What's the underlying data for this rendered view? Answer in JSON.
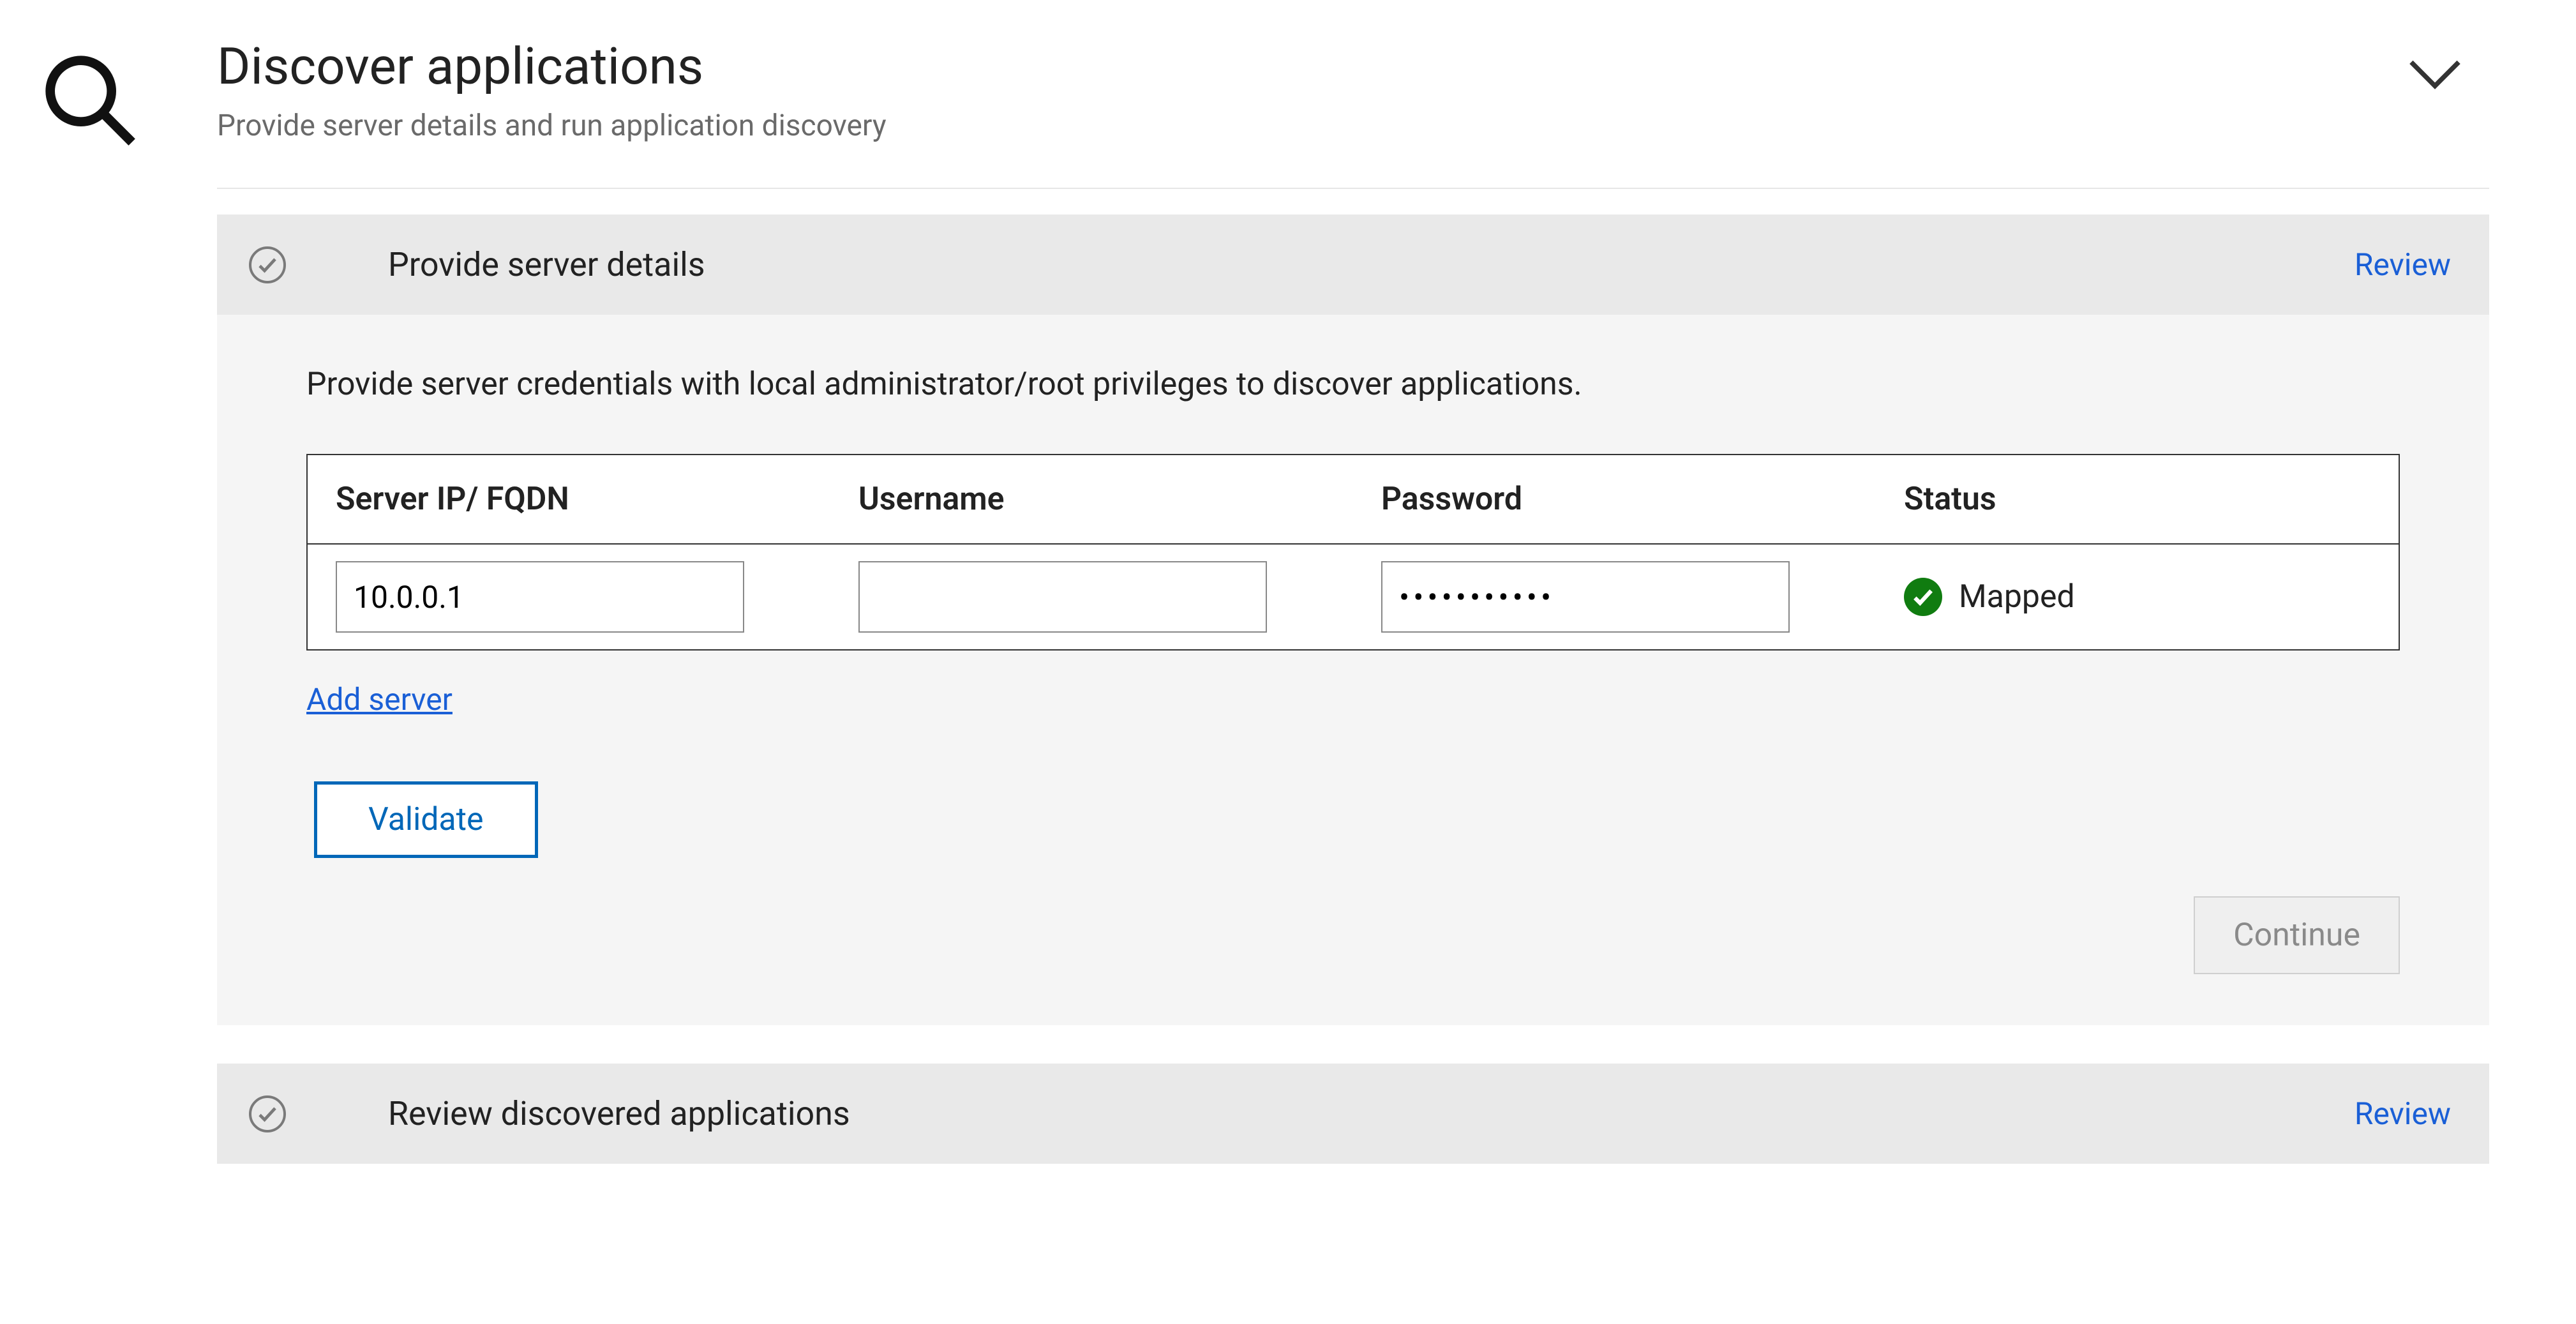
{
  "page": {
    "title": "Discover applications",
    "subtitle": "Provide server details and run application discovery"
  },
  "section1": {
    "title": "Provide server details",
    "review_label": "Review",
    "instructions": "Provide server credentials with local administrator/root privileges to discover applications.",
    "table": {
      "headers": {
        "server": "Server IP/ FQDN",
        "username": "Username",
        "password": "Password",
        "status": "Status"
      },
      "row": {
        "server": "10.0.0.1",
        "username": "",
        "password": "•••••••••••",
        "status": "Mapped"
      }
    },
    "add_server_label": "Add server",
    "validate_label": "Validate",
    "continue_label": "Continue"
  },
  "section2": {
    "title": "Review discovered applications",
    "review_label": "Review"
  }
}
